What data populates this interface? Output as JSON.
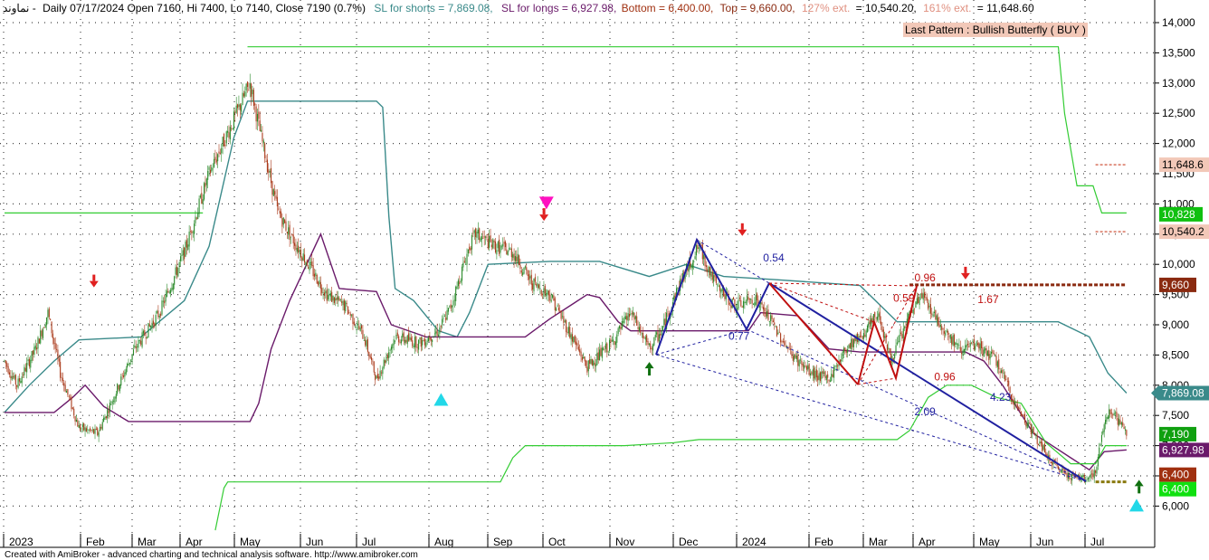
{
  "header": {
    "symbol": "نماوند -",
    "ohlc": "Daily 07/17/2024 Open 7160, Hi 7400, Lo 7140, Close 7190 (0.7%)",
    "sl_shorts": "SL for shorts  = 7,869.08,",
    "sl_longs": "SL for longs  = 6,927.98,",
    "bottom": "Bottom = 6,400.00,",
    "top": "Top = 9,660.00,",
    "ext127_name": "127% ext.",
    "ext127_val": "= 10,540.20,",
    "ext161_name": "161% ext.",
    "ext161_val": "= 11,648.60"
  },
  "pattern_label": "Last Pattern : Bullish Butterfly ( BUY )",
  "footer": "Created with AmiBroker - advanced charting and technical analysis software. http://www.amibroker.com",
  "colors": {
    "sl_shorts": "#3a8a8a",
    "sl_longs": "#6a1a6a",
    "green_band": "#33cc33",
    "candle_up": "#2a8a2a",
    "candle_down": "#aa3a1a",
    "bottom": "#a03010",
    "top": "#8a2a10",
    "ext": "#e09080",
    "pattern_bg": "#f2c8b8",
    "wave_blue": "#2020a0",
    "wave_red": "#c01010"
  },
  "chart_data": {
    "type": "candlestick",
    "ylim": [
      5600,
      14500
    ],
    "y_ticks": [
      "6,000",
      "6,500",
      "7,000",
      "7,500",
      "8,000",
      "8,500",
      "9,000",
      "9,500",
      "10,000",
      "10,500",
      "11,000",
      "11,500",
      "12,000",
      "12,500",
      "13,000",
      "13,500",
      "14,000"
    ],
    "x_tick_labels": [
      "2023",
      "Feb",
      "Mar",
      "Apr",
      "May",
      "Jun",
      "Jul",
      "Aug",
      "Sep",
      "Oct",
      "Nov",
      "Dec",
      "2024",
      "Feb",
      "Mar",
      "Apr",
      "May",
      "Jun",
      "Jul"
    ],
    "price_anchors": [
      [
        0,
        8400
      ],
      [
        10,
        8000
      ],
      [
        25,
        8600
      ],
      [
        35,
        9200
      ],
      [
        45,
        8200
      ],
      [
        60,
        7300
      ],
      [
        75,
        7200
      ],
      [
        90,
        7900
      ],
      [
        105,
        8600
      ],
      [
        125,
        9200
      ],
      [
        145,
        10200
      ],
      [
        165,
        11500
      ],
      [
        185,
        12400
      ],
      [
        198,
        13000
      ],
      [
        206,
        12200
      ],
      [
        220,
        10900
      ],
      [
        230,
        10500
      ],
      [
        245,
        10000
      ],
      [
        260,
        9500
      ],
      [
        275,
        9300
      ],
      [
        290,
        8800
      ],
      [
        300,
        8100
      ],
      [
        315,
        8800
      ],
      [
        335,
        8700
      ],
      [
        350,
        8900
      ],
      [
        360,
        9300
      ],
      [
        375,
        10300
      ],
      [
        380,
        10500
      ],
      [
        395,
        10300
      ],
      [
        410,
        10200
      ],
      [
        425,
        9700
      ],
      [
        440,
        9500
      ],
      [
        455,
        8900
      ],
      [
        470,
        8300
      ],
      [
        490,
        8700
      ],
      [
        505,
        9200
      ],
      [
        520,
        8600
      ],
      [
        530,
        8900
      ],
      [
        545,
        9700
      ],
      [
        560,
        10300
      ],
      [
        575,
        9600
      ],
      [
        590,
        9300
      ],
      [
        605,
        9450
      ],
      [
        620,
        9000
      ],
      [
        635,
        8500
      ],
      [
        650,
        8200
      ],
      [
        665,
        8100
      ],
      [
        680,
        8650
      ],
      [
        695,
        8900
      ],
      [
        705,
        9200
      ],
      [
        715,
        8400
      ],
      [
        730,
        9150
      ],
      [
        740,
        9500
      ],
      [
        755,
        9000
      ],
      [
        770,
        8600
      ],
      [
        785,
        8650
      ],
      [
        800,
        8400
      ],
      [
        815,
        7700
      ],
      [
        830,
        7200
      ],
      [
        845,
        6700
      ],
      [
        860,
        6500
      ],
      [
        870,
        6450
      ],
      [
        880,
        6550
      ],
      [
        887,
        7400
      ],
      [
        892,
        7600
      ],
      [
        905,
        7200
      ]
    ],
    "sl_shorts_anchors": [
      [
        0,
        7550
      ],
      [
        20,
        8000
      ],
      [
        40,
        8400
      ],
      [
        60,
        8750
      ],
      [
        110,
        8800
      ],
      [
        145,
        9400
      ],
      [
        165,
        10300
      ],
      [
        185,
        12100
      ],
      [
        196,
        12700
      ],
      [
        300,
        12700
      ],
      [
        305,
        12600
      ],
      [
        310,
        10800
      ],
      [
        315,
        9600
      ],
      [
        330,
        9400
      ],
      [
        350,
        8900
      ],
      [
        365,
        8800
      ],
      [
        375,
        9200
      ],
      [
        390,
        10000
      ],
      [
        440,
        10050
      ],
      [
        480,
        10050
      ],
      [
        520,
        9800
      ],
      [
        550,
        10000
      ],
      [
        580,
        9800
      ],
      [
        620,
        9750
      ],
      [
        690,
        9650
      ],
      [
        720,
        9050
      ],
      [
        850,
        9050
      ],
      [
        875,
        8800
      ],
      [
        890,
        8200
      ],
      [
        905,
        7870
      ]
    ],
    "sl_longs_anchors": [
      [
        0,
        7550
      ],
      [
        40,
        7550
      ],
      [
        55,
        7800
      ],
      [
        65,
        8000
      ],
      [
        80,
        7650
      ],
      [
        100,
        7400
      ],
      [
        185,
        7400
      ],
      [
        198,
        7400
      ],
      [
        205,
        7700
      ],
      [
        215,
        8600
      ],
      [
        230,
        9400
      ],
      [
        255,
        10500
      ],
      [
        270,
        9600
      ],
      [
        300,
        9550
      ],
      [
        312,
        9000
      ],
      [
        340,
        8800
      ],
      [
        420,
        8800
      ],
      [
        440,
        9100
      ],
      [
        470,
        9500
      ],
      [
        480,
        9450
      ],
      [
        495,
        9050
      ],
      [
        505,
        8900
      ],
      [
        520,
        8900
      ],
      [
        600,
        8900
      ],
      [
        610,
        9200
      ],
      [
        640,
        9150
      ],
      [
        665,
        8600
      ],
      [
        690,
        8550
      ],
      [
        740,
        8550
      ],
      [
        775,
        8550
      ],
      [
        790,
        8400
      ],
      [
        805,
        8000
      ],
      [
        830,
        7200
      ],
      [
        845,
        7000
      ],
      [
        860,
        6800
      ],
      [
        875,
        6600
      ],
      [
        887,
        6900
      ],
      [
        905,
        6930
      ]
    ],
    "green_band_segments": [
      [
        [
          0,
          10850
        ],
        [
          160,
          10850
        ]
      ],
      [
        [
          170,
          5600
        ],
        [
          177,
          6300
        ],
        [
          180,
          6400
        ],
        [
          400,
          6400
        ],
        [
          410,
          6800
        ],
        [
          420,
          7000
        ],
        [
          500,
          7000
        ],
        [
          540,
          7050
        ],
        [
          560,
          7100
        ],
        [
          720,
          7100
        ],
        [
          730,
          7250
        ],
        [
          745,
          7800
        ],
        [
          760,
          8000
        ],
        [
          780,
          8000
        ],
        [
          800,
          7800
        ],
        [
          820,
          7700
        ],
        [
          840,
          7050
        ],
        [
          860,
          6700
        ],
        [
          878,
          6700
        ],
        [
          880,
          6700
        ],
        [
          888,
          7000
        ],
        [
          905,
          7000
        ]
      ],
      [
        [
          196,
          13600
        ],
        [
          850,
          13600
        ],
        [
          855,
          12500
        ],
        [
          865,
          11300
        ],
        [
          878,
          11300
        ],
        [
          885,
          10850
        ],
        [
          905,
          10850
        ]
      ]
    ],
    "level_lines": [
      {
        "name": "Top",
        "value": 9660,
        "from": 730,
        "to": 905,
        "style": "thick-dashed"
      },
      {
        "name": "Bottom",
        "value": 6400,
        "from": 880,
        "to": 905,
        "style": "thick-dashed"
      },
      {
        "name": "127% ext.",
        "value": 10540.2,
        "from": 880,
        "to": 905,
        "style": "dashed"
      },
      {
        "name": "161% ext.",
        "value": 11648.6,
        "from": 880,
        "to": 905,
        "style": "dashed"
      }
    ],
    "price_labels": [
      {
        "text": "11,648.6",
        "value": 11648.6
      },
      {
        "text": "10,828",
        "value": 10828
      },
      {
        "text": "10,540.2",
        "value": 10540.2
      },
      {
        "text": "9,660",
        "value": 9660
      },
      {
        "text": "7,869.08",
        "value": 7869.08
      },
      {
        "text": "7,190",
        "value": 7190
      },
      {
        "text": "6,927.98",
        "value": 6927.98
      },
      {
        "text": "6,400",
        "value": 6400
      },
      {
        "text": "6,400",
        "value": 6400
      }
    ],
    "ratio_labels": [
      {
        "text": "0.54",
        "bar": 590,
        "value": 10050
      },
      {
        "text": "0.77",
        "bar": 562,
        "value": 8750
      },
      {
        "text": "0.96",
        "bar": 712,
        "value": 9720
      },
      {
        "text": "0.59",
        "bar": 695,
        "value": 9380
      },
      {
        "text": "1.67",
        "bar": 763,
        "value": 9360
      },
      {
        "text": "0.96",
        "bar": 728,
        "value": 8080
      },
      {
        "text": "4.23",
        "bar": 773,
        "value": 7740
      },
      {
        "text": "2.09",
        "bar": 712,
        "value": 7500
      }
    ],
    "signals": [
      {
        "type": "sell-arrow",
        "bar": 40,
        "value": 9650
      },
      {
        "type": "buy-triangle",
        "bar": 320,
        "value": 7750
      },
      {
        "type": "sell-triangle",
        "bar": 405,
        "value": 11000
      },
      {
        "type": "sell-arrow",
        "bar": 403,
        "value": 10750
      },
      {
        "type": "buy-arrow",
        "bar": 488,
        "value": 8250
      },
      {
        "type": "sell-arrow",
        "bar": 563,
        "value": 10500
      },
      {
        "type": "sell-arrow",
        "bar": 743,
        "value": 9780
      },
      {
        "type": "buy-arrow",
        "bar": 883,
        "value": 6300
      },
      {
        "type": "buy-triangle",
        "bar": 881,
        "value": 6000
      }
    ]
  }
}
